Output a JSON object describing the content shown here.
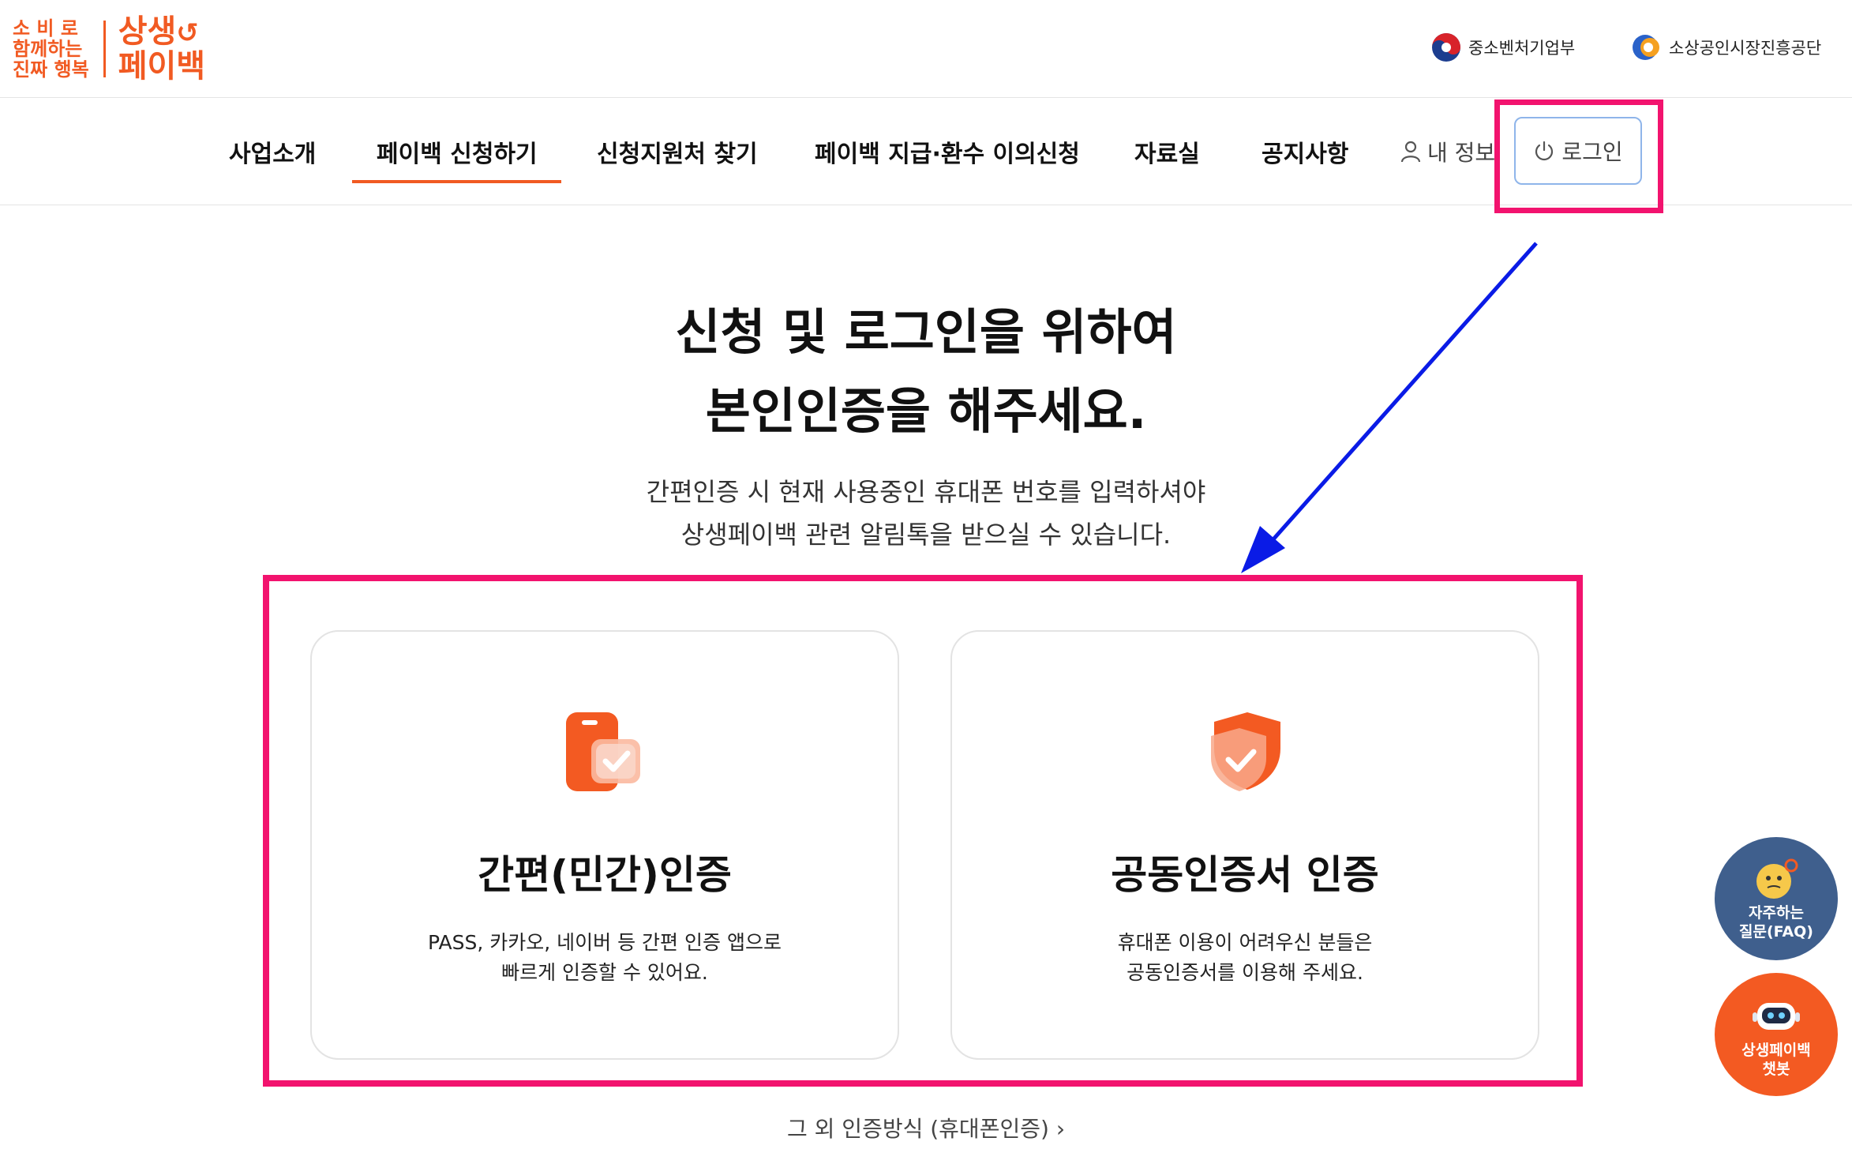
{
  "header": {
    "logo_small_lines": [
      "소 비 로",
      "함께하는",
      "진짜 행복"
    ],
    "logo_big_lines": [
      "상생",
      "페이백"
    ],
    "partner1": "중소벤처기업부",
    "partner2": "소상공인시장진흥공단"
  },
  "nav": {
    "items": [
      "사업소개",
      "페이백 신청하기",
      "신청지원처 찾기",
      "페이백 지급·환수 이의신청",
      "자료실",
      "공지사항"
    ],
    "active_index": 1,
    "my_info": "내 정보",
    "login": "로그인"
  },
  "main": {
    "headline": [
      "신청 및 로그인을 위하여",
      "본인인증을 해주세요."
    ],
    "subline": [
      "간편인증 시 현재 사용중인 휴대폰 번호를 입력하셔야",
      "상생페이백 관련 알림톡을 받으실 수 있습니다."
    ]
  },
  "cards": [
    {
      "icon": "phone-check-icon",
      "title": "간편(민간)인증",
      "desc": [
        "PASS, 카카오, 네이버 등 간편 인증 앱으로",
        "빠르게 인증할 수 있어요."
      ]
    },
    {
      "icon": "shield-check-icon",
      "title": "공동인증서 인증",
      "desc": [
        "휴대폰 이용이 어려우신 분들은",
        "공동인증서를 이용해 주세요."
      ]
    }
  ],
  "other_auth": "그 외 인증방식 (휴대폰인증)",
  "floating": {
    "faq": [
      "자주하는",
      "질문(FAQ)"
    ],
    "chatbot": [
      "상생페이백",
      "챗봇"
    ]
  },
  "colors": {
    "brand_orange": "#f15a22",
    "highlight_pink": "#f2136e",
    "annotation_blue": "#0a1be6",
    "faq_blue": "#3f5f8d"
  }
}
